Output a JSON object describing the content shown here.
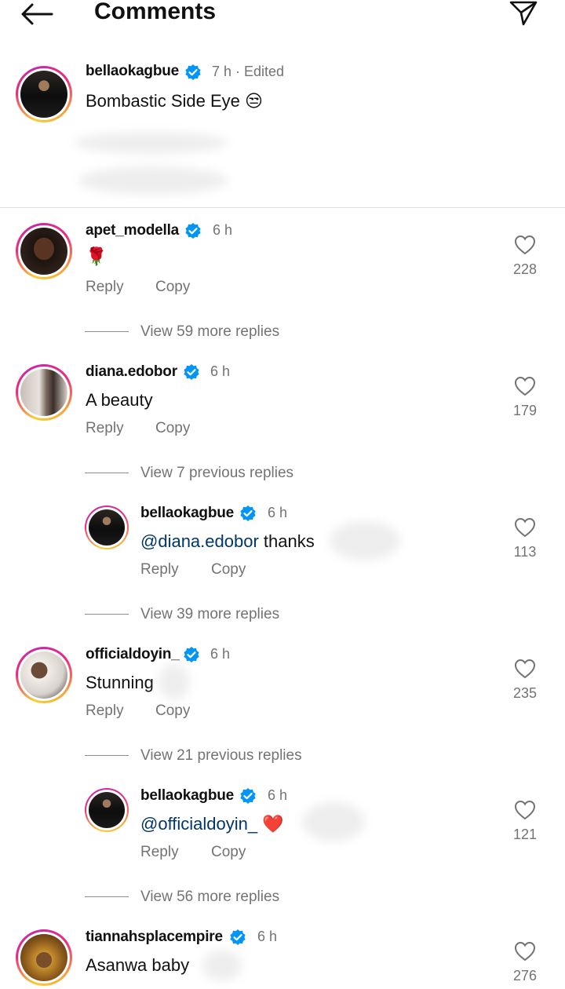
{
  "header": {
    "title": "Comments"
  },
  "post": {
    "username": "bellaokagbue",
    "time": "7 h · Edited",
    "caption": "Bombastic Side Eye 😒"
  },
  "actions": {
    "reply": "Reply",
    "copy": "Copy"
  },
  "comments": [
    {
      "username": "apet_modella",
      "time": "6 h",
      "text": "🌹",
      "likes": "228",
      "view_replies": "View 59 more replies"
    },
    {
      "username": "diana.edobor",
      "time": "6 h",
      "text": "A beauty",
      "likes": "179",
      "view_replies": "View 7 previous replies",
      "reply": {
        "username": "bellaokagbue",
        "time": "6 h",
        "mention": "@diana.edobor",
        "text": " thanks",
        "likes": "113",
        "view_replies": "View 39 more replies"
      }
    },
    {
      "username": "officialdoyin_",
      "time": "6 h",
      "text": "Stunning",
      "likes": "235",
      "view_replies": "View 21 previous replies",
      "reply": {
        "username": "bellaokagbue",
        "time": "6 h",
        "mention": "@officialdoyin_",
        "text": " ❤️",
        "likes": "121",
        "view_replies": "View 56 more replies"
      }
    },
    {
      "username": "tiannahsplacempire",
      "time": "6 h",
      "text": "Asanwa baby",
      "likes": "276"
    }
  ],
  "icons": {
    "back": "arrow-left-icon",
    "send": "paper-plane-icon",
    "verified": "verified-badge-icon",
    "like": "heart-outline-icon"
  },
  "colors": {
    "verified": "#0095f6",
    "mention": "#00376b",
    "secondary_text": "#737373"
  }
}
